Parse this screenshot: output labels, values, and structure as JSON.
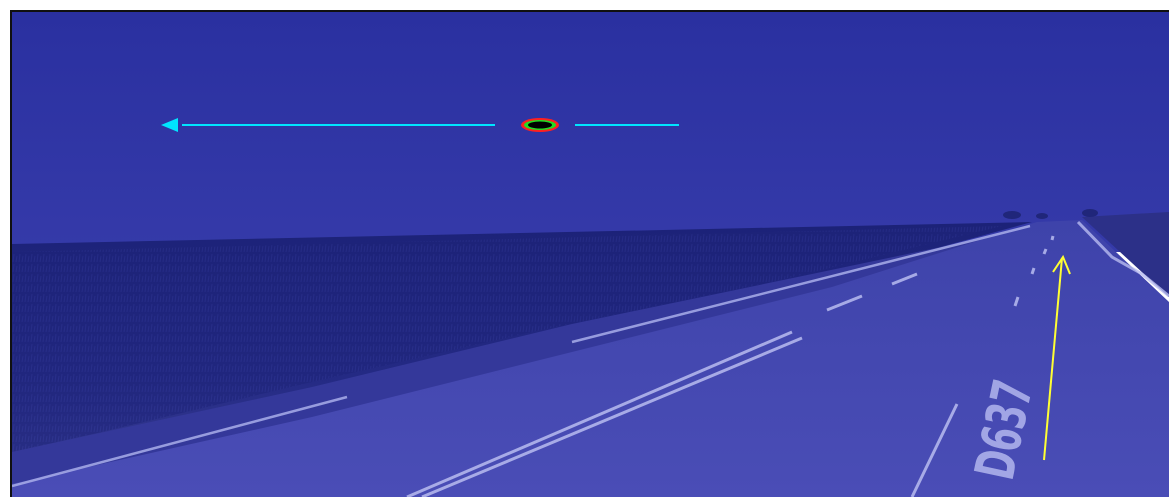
{
  "scene": {
    "colors": {
      "sky_top": "#2a30a0",
      "sky_horizon": "#3338a6",
      "field_dark": "#1b2173",
      "field_light": "#2a2e8c",
      "grass": "#3a3e95",
      "road": "#4548b0",
      "road_marking": "#b8bcf0",
      "cyan_arrow": "#00e5ff",
      "yellow_arrow": "#ffff33",
      "ellipse_outline": "#ff2020",
      "ellipse_ring": "#22dd22",
      "ellipse_center": "#000000"
    },
    "road_text": "D637"
  }
}
